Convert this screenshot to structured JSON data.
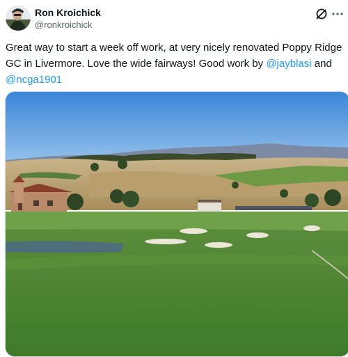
{
  "author": {
    "display_name": "Ron Kroichick",
    "handle": "@ronkroichick",
    "avatar": "avatar-photo"
  },
  "icons": {
    "grok": "grok-icon",
    "more": "more-options-icon"
  },
  "tweet": {
    "text_part1": "Great way to start a week off work, at very nicely renovated Poppy Ridge GC in Livermore. Love the wide fairways! Good work by ",
    "mention1": "@jayblasi",
    "text_part2": " and ",
    "mention2": "@ncga1901"
  },
  "media": {
    "type": "photo",
    "subject": "golf-course-photo"
  },
  "colors": {
    "link": "#1d9bf0",
    "text": "#0f1419",
    "secondary": "#536471"
  }
}
